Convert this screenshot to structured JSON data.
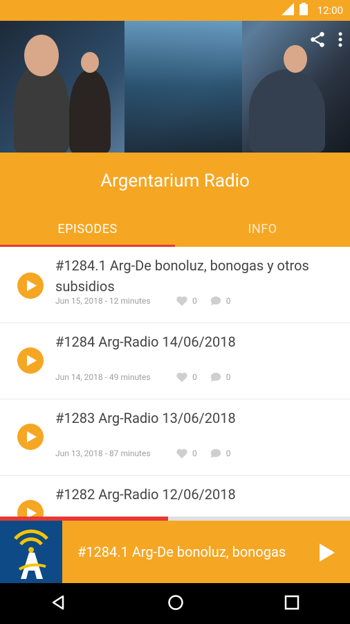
{
  "status": {
    "time": "12:00",
    "icons": [
      "signal-icon",
      "battery-icon"
    ]
  },
  "hero": {
    "actions": [
      "share-icon",
      "more-vert-icon"
    ]
  },
  "app": {
    "title": "Argentarium Radio"
  },
  "tabs": [
    {
      "label": "EPISODES",
      "active": true
    },
    {
      "label": "INFO",
      "active": false
    }
  ],
  "episodes": [
    {
      "title": "#1284.1 Arg-De bonoluz, bonogas y otros subsidios",
      "meta": "Jun 15, 2018 - 12 minutes",
      "likes": "0",
      "comments": "0"
    },
    {
      "title": "#1284 Arg-Radio 14/06/2018",
      "meta": "Jun 14, 2018 - 49 minutes",
      "likes": "0",
      "comments": "0"
    },
    {
      "title": "#1283 Arg-Radio 13/06/2018",
      "meta": "Jun 13, 2018 - 87 minutes",
      "likes": "0",
      "comments": "0"
    },
    {
      "title": "#1282 Arg-Radio 12/06/2018"
    }
  ],
  "player": {
    "title": "#1284.1 Arg-De bonoluz, bonogas",
    "progress": 0.48
  },
  "colors": {
    "accent": "#F5A623",
    "indicator": "#E53935"
  }
}
